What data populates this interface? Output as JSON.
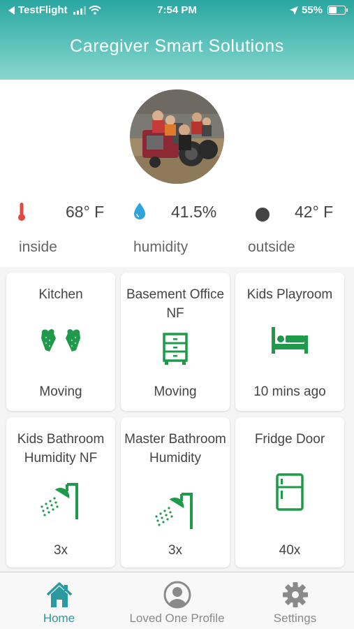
{
  "status_bar": {
    "back_app": "TestFlight",
    "time": "7:54 PM",
    "battery": "55%",
    "battery_level": 0.55,
    "icons": [
      "back-arrow-icon",
      "signal-icon",
      "wifi-icon",
      "location-arrow-icon",
      "battery-icon"
    ]
  },
  "header": {
    "title": "Caregiver Smart Solutions"
  },
  "profile": {
    "avatar_icon": "profile-photo"
  },
  "metrics": [
    {
      "value": "68° F",
      "label": "inside",
      "icon": "thermometer-icon",
      "color": "#e04a3f"
    },
    {
      "value": "41.5%",
      "label": "humidity",
      "icon": "water-drop-icon",
      "color": "#2ea3e0"
    },
    {
      "value": "42° F",
      "label": "outside",
      "icon": "dark-circle-icon",
      "color": "#444444"
    }
  ],
  "tiles": [
    {
      "name": "Kitchen",
      "status": "Moving",
      "icon": "oven-mitts-icon"
    },
    {
      "name": "Basement Office NF",
      "status": "Moving",
      "icon": "dresser-icon"
    },
    {
      "name": "Kids Playroom",
      "status": "10 mins ago",
      "icon": "bed-icon"
    },
    {
      "name": "Kids Bathroom Humidity NF",
      "status": "3x",
      "icon": "shower-icon"
    },
    {
      "name": "Master Bathroom Humidity",
      "status": "3x",
      "icon": "shower-icon"
    },
    {
      "name": "Fridge Door",
      "status": "40x",
      "icon": "fridge-icon"
    }
  ],
  "tabs": [
    {
      "label": "Home",
      "icon": "home-icon",
      "active": true
    },
    {
      "label": "Loved One Profile",
      "icon": "person-circle-icon",
      "active": false
    },
    {
      "label": "Settings",
      "icon": "gear-icon",
      "active": false
    }
  ],
  "colors": {
    "header_gradient_top": "#2aa6a0",
    "header_gradient_bottom": "#8ad6cf",
    "icon_green": "#1e9a4a",
    "active_tab": "#2a9aa0",
    "inactive_tab": "#8a8a8a"
  }
}
